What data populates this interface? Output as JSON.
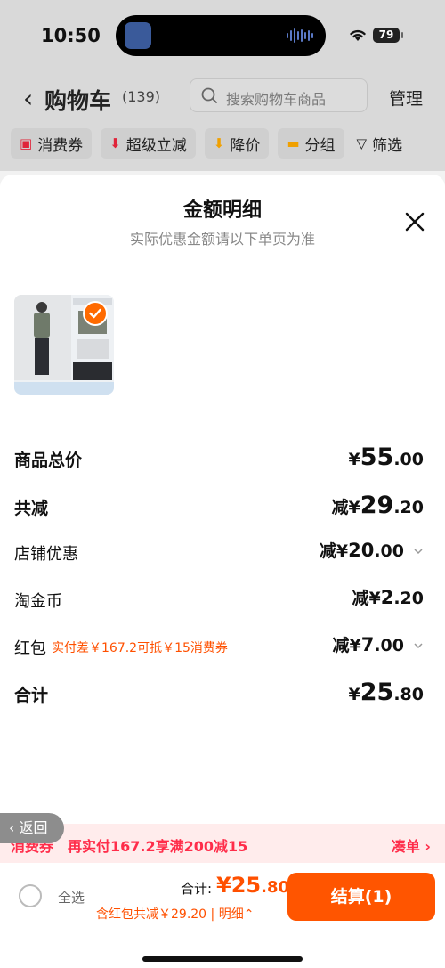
{
  "status_bar": {
    "time": "10:50",
    "battery": "79"
  },
  "header": {
    "back_glyph": "‹",
    "title": "购物车",
    "count": "(139)",
    "search_placeholder": "搜索购物车商品",
    "manage": "管理"
  },
  "filters": [
    {
      "label": "消费券",
      "icon": "ticket-icon",
      "glyph": "🎟"
    },
    {
      "label": "超级立减",
      "icon": "down-arrow-icon",
      "glyph": "⬇"
    },
    {
      "label": "降价",
      "icon": "price-drop-icon",
      "glyph": "⬇"
    },
    {
      "label": "分组",
      "icon": "folder-icon",
      "glyph": "▬"
    },
    {
      "label": "筛选",
      "icon": "filter-icon",
      "glyph": "▽"
    }
  ],
  "sheet": {
    "title": "金额明细",
    "subtitle": "实际优惠金额请以下单页为准",
    "rows": {
      "total_price": {
        "label": "商品总价",
        "currency": "¥",
        "int": "55",
        "dec": ".00"
      },
      "total_discount": {
        "label": "共减",
        "prefix": "减¥",
        "int": "29",
        "dec": ".20"
      },
      "store_discount": {
        "label": "店铺优惠",
        "prefix": "减¥",
        "int": "20",
        "dec": ".00"
      },
      "coins": {
        "label": "淘金币",
        "prefix": "减¥",
        "int": "2",
        "dec": ".20"
      },
      "red_packet": {
        "label": "红包",
        "tip": "实付差￥167.2可抵￥15消费券",
        "prefix": "减¥",
        "int": "7",
        "dec": ".00"
      },
      "grand_total": {
        "label": "合计",
        "currency": "¥",
        "int": "25",
        "dec": ".80"
      }
    }
  },
  "float_back": "‹ 返回",
  "coupon_strip": {
    "tag": "消费券",
    "message": "再实付167.2享满200减15",
    "action": "凑单 ›"
  },
  "bottom_bar": {
    "select_all": "全选",
    "total_label": "合计:",
    "total_value_int": "¥25",
    "total_value_dec": ".80",
    "total_sub": "含红包共减￥29.20 | 明细⌃",
    "checkout": "结算(1)"
  },
  "colors": {
    "accent": "#ff5000",
    "coupon": "#ff2d4a",
    "checkout_bg": "#ff5500"
  }
}
